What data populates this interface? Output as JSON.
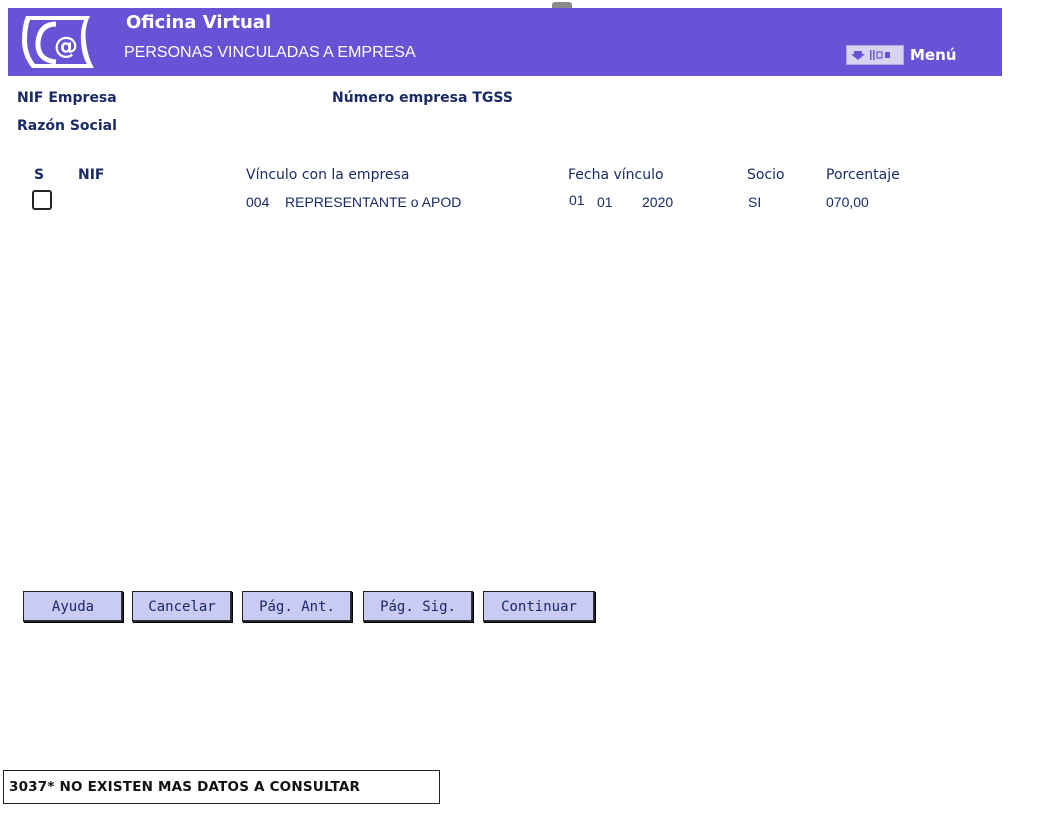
{
  "header": {
    "title": "Oficina Virtual",
    "subtitle": "PERSONAS VINCULADAS A EMPRESA",
    "menu_label": "Menú",
    "menu_icon": "menu-icon"
  },
  "company": {
    "nif_label": "NIF Empresa",
    "nif_value": "",
    "tgss_label": "Número empresa TGSS",
    "tgss_value": "",
    "razon_label": "Razón Social"
  },
  "table": {
    "headers": {
      "s": "S",
      "nif": "NIF",
      "vinculo": "Vínculo con la empresa",
      "fecha": "Fecha vínculo",
      "socio": "Socio",
      "porcentaje": "Porcentaje"
    },
    "rows": [
      {
        "selected": false,
        "nif": "",
        "vinculo_code": "004",
        "vinculo_desc": "REPRESENTANTE o APOD",
        "fecha_dd": "01",
        "fecha_mm": "01",
        "fecha_yyyy": "2020",
        "socio": "SI",
        "porcentaje": "070,00"
      }
    ]
  },
  "buttons": {
    "ayuda": "Ayuda",
    "cancelar": "Cancelar",
    "pag_ant": "Pág. Ant.",
    "pag_sig": "Pág. Sig.",
    "continuar": "Continuar"
  },
  "status": {
    "message": "3037* NO EXISTEN MAS DATOS A CONSULTAR"
  },
  "colors": {
    "header_bg": "#6a52d6",
    "button_bg": "#c9cbf5",
    "text": "#1a2a66"
  }
}
